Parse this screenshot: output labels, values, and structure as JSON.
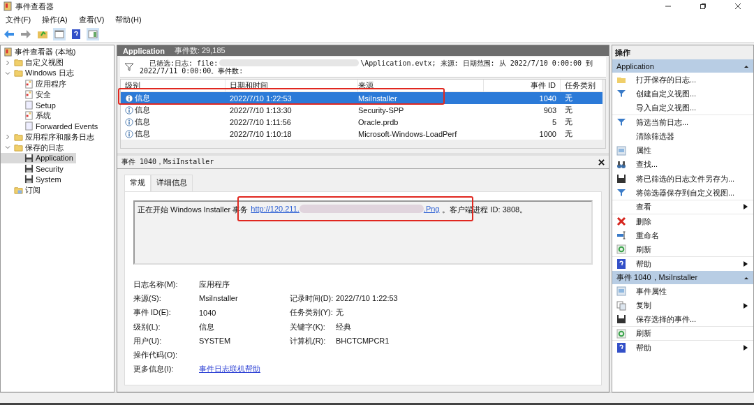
{
  "window": {
    "title": "事件查看器"
  },
  "menu": [
    {
      "label": "文件(F)"
    },
    {
      "label": "操作(A)"
    },
    {
      "label": "查看(V)"
    },
    {
      "label": "帮助(H)"
    }
  ],
  "tree": [
    {
      "label": "事件查看器 (本地)",
      "kind": "root",
      "selected": false,
      "children": [
        {
          "label": "自定义视图",
          "kind": "folder",
          "expanded": false,
          "selected": false
        },
        {
          "label": "Windows 日志",
          "kind": "folder",
          "expanded": true,
          "selected": false,
          "children": [
            {
              "label": "应用程序",
              "kind": "log",
              "selected": false
            },
            {
              "label": "安全",
              "kind": "log",
              "selected": false
            },
            {
              "label": "Setup",
              "kind": "plain",
              "selected": false
            },
            {
              "label": "系统",
              "kind": "log",
              "selected": false
            },
            {
              "label": "Forwarded Events",
              "kind": "plain",
              "selected": false
            }
          ]
        },
        {
          "label": "应用程序和服务日志",
          "kind": "folder",
          "expanded": false,
          "selected": false
        },
        {
          "label": "保存的日志",
          "kind": "folder",
          "expanded": true,
          "selected": false,
          "children": [
            {
              "label": "Application",
              "kind": "saved",
              "selected": true
            },
            {
              "label": "Security",
              "kind": "saved",
              "selected": false
            },
            {
              "label": "System",
              "kind": "saved",
              "selected": false
            }
          ]
        },
        {
          "label": "订阅",
          "kind": "subscription",
          "selected": false
        }
      ]
    }
  ],
  "log_header": {
    "title": "Application",
    "count": "事件数: 29,185"
  },
  "filter": {
    "line_1_start": "已筛选:日志: file:",
    "line_1_end": "\\Application.evtx; 来源: 日期范围: 从 2022/7/10 0:00:00 到",
    "line_2": "2022/7/11 0:00:00。事件数:"
  },
  "table": {
    "columns": [
      "级别",
      "日期和时间",
      "来源",
      "事件 ID",
      "任务类别"
    ],
    "rows": [
      {
        "level": "信息",
        "date": "2022/7/10 1:22:53",
        "source": "MsiInstaller",
        "event_id": "1040",
        "task": "无",
        "selected": true,
        "highlighted": true
      },
      {
        "level": "信息",
        "date": "2022/7/10 1:13:30",
        "source": "Security-SPP",
        "event_id": "903",
        "task": "无",
        "selected": false,
        "highlighted": false
      },
      {
        "level": "信息",
        "date": "2022/7/10 1:11:56",
        "source": "Oracle.prdb",
        "event_id": "5",
        "task": "无",
        "selected": false,
        "highlighted": false
      },
      {
        "level": "信息",
        "date": "2022/7/10 1:10:18",
        "source": "Microsoft-Windows-LoadPerf",
        "event_id": "1000",
        "task": "无",
        "selected": false,
        "highlighted": false
      }
    ]
  },
  "details": {
    "title": "事件 1040，MsiInstaller",
    "tabs": [
      {
        "label": "常规",
        "selected": true
      },
      {
        "label": "详细信息",
        "selected": false
      }
    ],
    "message": {
      "before": "正在开始 Windows Installer 事务",
      "link_start": "http://120.211.",
      "link_end": ".Png",
      "after": "。客户端进程 ID: 3808。",
      "highlighted": true
    },
    "fields": [
      {
        "label": "日志名称(M):",
        "value": "应用程序",
        "kind": "text"
      },
      {
        "label": "来源(S):",
        "value": "MsiInstaller",
        "kind": "text",
        "right_label": "记录时间(D):",
        "right_value": "2022/7/10 1:22:53"
      },
      {
        "label": "事件 ID(E):",
        "value": "1040",
        "kind": "text",
        "right_label": "任务类别(Y):",
        "right_value": "无"
      },
      {
        "label": "级别(L):",
        "value": "信息",
        "kind": "text",
        "right_label": "关键字(K):",
        "right_value": "经典"
      },
      {
        "label": "用户(U):",
        "value": "SYSTEM",
        "kind": "text",
        "right_label": "计算机(R):",
        "right_value": "BHCTCMPCR1"
      },
      {
        "label": "操作代码(O):",
        "kind": "text"
      },
      {
        "label": "更多信息(I):",
        "value": "事件日志联机帮助",
        "kind": "link"
      }
    ]
  },
  "actions": {
    "title": "操作",
    "sections": [
      {
        "title": "Application",
        "expanded": true,
        "items": [
          {
            "label": "打开保存的日志...",
            "kind": "open",
            "submenu": false,
            "divider_after": false
          },
          {
            "label": "创建自定义视图...",
            "kind": "filter",
            "submenu": false,
            "divider_after": false
          },
          {
            "label": "导入自定义视图...",
            "kind": "plain",
            "submenu": false,
            "divider_after": true
          },
          {
            "label": "筛选当前日志...",
            "kind": "filter",
            "submenu": false,
            "divider_after": false
          },
          {
            "label": "清除筛选器",
            "kind": "plain",
            "submenu": false,
            "divider_after": false
          },
          {
            "label": "属性",
            "kind": "properties",
            "submenu": false,
            "divider_after": false
          },
          {
            "label": "查找...",
            "kind": "find",
            "submenu": false,
            "divider_after": false
          },
          {
            "label": "将已筛选的日志文件另存为...",
            "kind": "save",
            "submenu": false,
            "divider_after": false
          },
          {
            "label": "将筛选器保存到自定义视图...",
            "kind": "filter",
            "submenu": false,
            "divider_after": true
          },
          {
            "label": "查看",
            "kind": "plain",
            "submenu": true,
            "divider_after": true
          },
          {
            "label": "删除",
            "kind": "delete",
            "submenu": false,
            "divider_after": false
          },
          {
            "label": "重命名",
            "kind": "rename",
            "submenu": false,
            "divider_after": false
          },
          {
            "label": "刷新",
            "kind": "refresh",
            "submenu": false,
            "divider_after": true
          },
          {
            "label": "帮助",
            "kind": "help",
            "submenu": true,
            "divider_after": false
          }
        ]
      },
      {
        "title": "事件 1040，MsiInstaller",
        "expanded": true,
        "items": [
          {
            "label": "事件属性",
            "kind": "properties",
            "submenu": false,
            "divider_after": false
          },
          {
            "label": "复制",
            "kind": "copy",
            "submenu": true,
            "divider_after": false
          },
          {
            "label": "保存选择的事件...",
            "kind": "save",
            "submenu": false,
            "divider_after": true
          },
          {
            "label": "刷新",
            "kind": "refresh",
            "submenu": false,
            "divider_after": true
          },
          {
            "label": "帮助",
            "kind": "help",
            "submenu": true,
            "divider_after": false
          }
        ]
      }
    ]
  }
}
